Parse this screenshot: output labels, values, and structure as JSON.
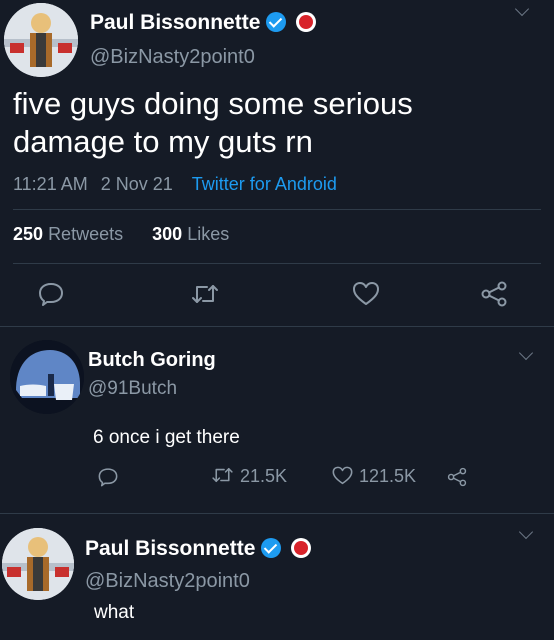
{
  "tweet": {
    "author_name": "Paul Bissonnette",
    "author_handle": "@BizNasty2point0",
    "text_line1": "five guys doing some serious",
    "text_line2": "damage to my guts rn",
    "time": "11:21 AM",
    "date": "2 Nov 21",
    "source": "Twitter for Android",
    "retweets_count": "250",
    "retweets_label": "Retweets",
    "likes_count": "300",
    "likes_label": "Likes"
  },
  "reply1": {
    "author_name": "Butch Goring",
    "author_handle": "@91Butch",
    "text": "6 once i get there",
    "retweets": "21.5K",
    "likes": "121.5K"
  },
  "reply2": {
    "author_name": "Paul Bissonnette",
    "author_handle": "@BizNasty2point0",
    "text": "what"
  },
  "icons": [
    "chevron-down-icon",
    "verified-badge-icon",
    "barstool-badge-icon",
    "reply-icon",
    "retweet-icon",
    "like-icon",
    "share-icon"
  ],
  "colors": {
    "background": "#151b26",
    "link": "#1d9bf0",
    "muted": "#8b98a5",
    "verified": "#1d9bf0"
  }
}
